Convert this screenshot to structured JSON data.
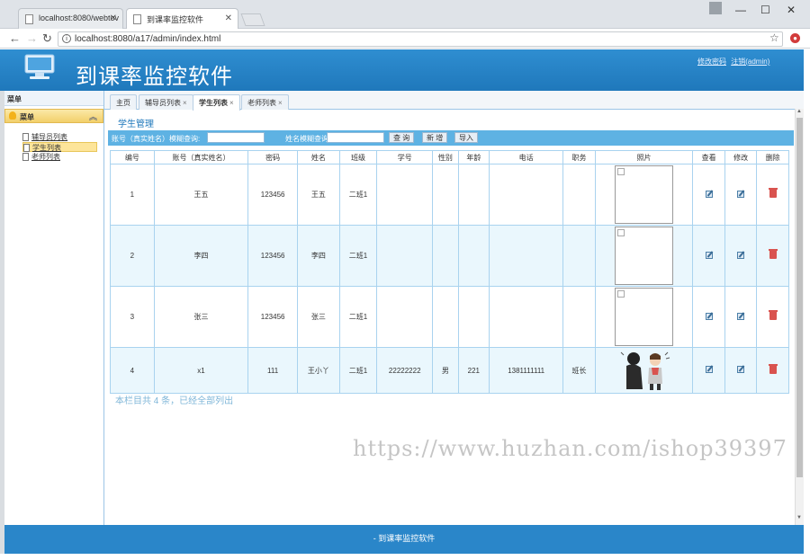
{
  "browser": {
    "tabs": [
      {
        "label": "localhost:8080/webtov",
        "active": false
      },
      {
        "label": "到课率监控软件",
        "active": true
      }
    ],
    "url": "localhost:8080/a17/admin/index.html"
  },
  "app": {
    "title": "到课率监控软件",
    "header_links": [
      "修改密码",
      "注销(admin)"
    ]
  },
  "sidebar": {
    "title": "菜单",
    "panel_label": "菜单",
    "items": [
      {
        "label": "辅导员列表",
        "active": false
      },
      {
        "label": "学生列表",
        "active": true
      },
      {
        "label": "老师列表",
        "active": false
      }
    ]
  },
  "tabs": [
    {
      "label": "主页",
      "closable": false,
      "active": false
    },
    {
      "label": "辅导员列表",
      "closable": true,
      "active": false
    },
    {
      "label": "学生列表",
      "closable": true,
      "active": true
    },
    {
      "label": "老师列表",
      "closable": true,
      "active": false
    }
  ],
  "section_title": "学生管理",
  "search": {
    "account_label": "账号（真实姓名）模糊查询:",
    "name_label": "姓名模糊查询:",
    "query_button": "查 询",
    "add_button": "新 增",
    "import_button": "导入"
  },
  "table": {
    "headers": [
      "编号",
      "账号（真实姓名）",
      "密码",
      "姓名",
      "班级",
      "学号",
      "性别",
      "年龄",
      "电话",
      "职务",
      "照片",
      "查看",
      "修改",
      "删除"
    ],
    "rows": [
      {
        "id": "1",
        "account": "王五",
        "password": "123456",
        "name": "王五",
        "class": "二班1",
        "student_no": "",
        "gender": "",
        "age": "",
        "phone": "",
        "role": "",
        "photo": "broken"
      },
      {
        "id": "2",
        "account": "李四",
        "password": "123456",
        "name": "李四",
        "class": "二班1",
        "student_no": "",
        "gender": "",
        "age": "",
        "phone": "",
        "role": "",
        "photo": "broken"
      },
      {
        "id": "3",
        "account": "张三",
        "password": "123456",
        "name": "张三",
        "class": "二班1",
        "student_no": "",
        "gender": "",
        "age": "",
        "phone": "",
        "role": "",
        "photo": "broken"
      },
      {
        "id": "4",
        "account": "x1",
        "password": "111",
        "name": "王小丫",
        "class": "二班1",
        "student_no": "22222222",
        "gender": "男",
        "age": "221",
        "phone": "1381111111",
        "role": "班长",
        "photo": "cartoon"
      }
    ]
  },
  "footer_note": "本栏目共 4 条，已经全部列出",
  "watermark": "https://www.huzhan.com/ishop39397",
  "footer": "- 到课率监控软件",
  "colors": {
    "header": "#2a86c9",
    "accent": "#5eb2e3",
    "row_alt": "#eaf7fd"
  }
}
